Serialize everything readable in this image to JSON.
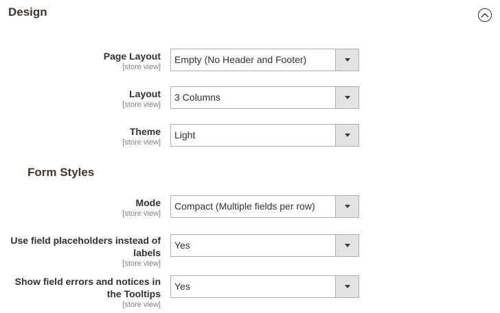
{
  "section": {
    "title": "Design"
  },
  "fields": [
    {
      "label": "Page Layout",
      "scope": "[store view]",
      "value": "Empty (No Header and Footer)"
    },
    {
      "label": "Layout",
      "scope": "[store view]",
      "value": "3 Columns"
    },
    {
      "label": "Theme",
      "scope": "[store view]",
      "value": "Light"
    }
  ],
  "form_styles": {
    "title": "Form Styles",
    "fields": [
      {
        "label": "Mode",
        "scope": "[store view]",
        "value": "Compact (Multiple fields per row)"
      },
      {
        "label_line1": "Use field placeholders instead of",
        "label_line2": "labels",
        "scope": "[store view]",
        "value": "Yes"
      },
      {
        "label_line1": "Show field errors and notices in",
        "label_line2": "the Tooltips",
        "scope": "[store view]",
        "value": "Yes"
      }
    ]
  },
  "icons": {
    "collapse": "chevron-up-circle-icon",
    "dropdown_arrow": "caret-down-icon"
  }
}
